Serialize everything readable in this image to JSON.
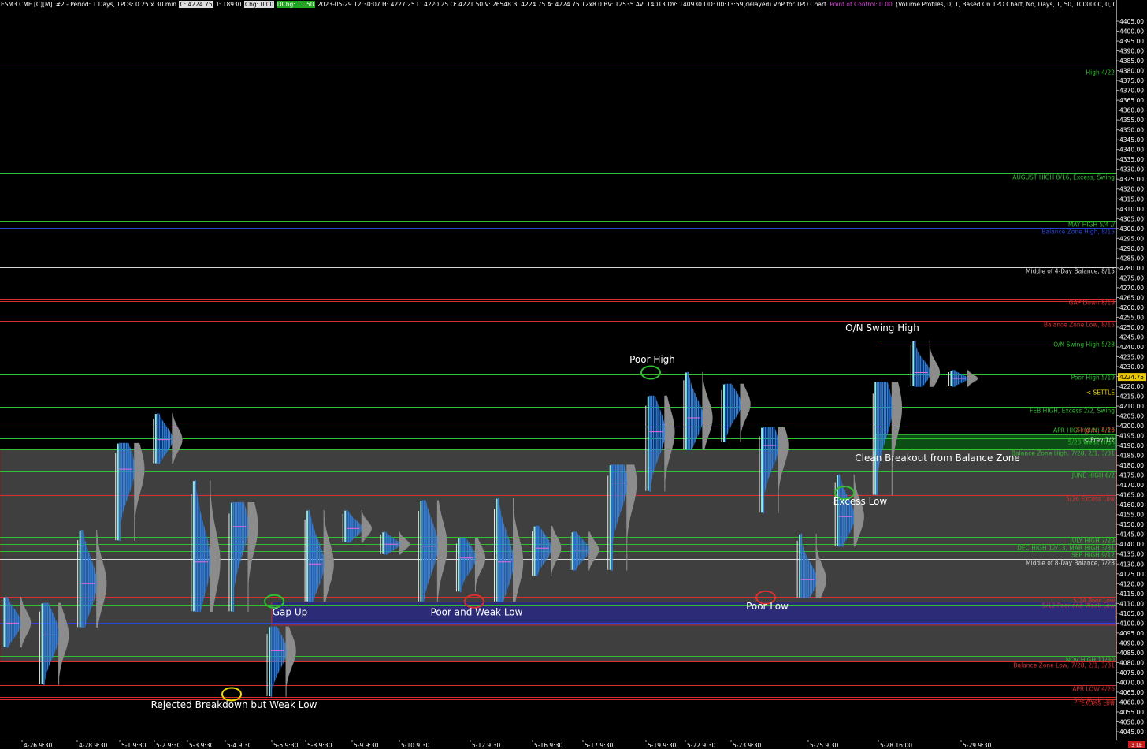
{
  "header": {
    "symbol": "ESM3.CME [C][M]",
    "period": "#2 - Period: 1 Days, TPOs: 0.25 x 30 min",
    "last": "C: 4224.75",
    "ticks": "T: 18930",
    "change": "Chg: 0.00",
    "dchange": "DChg: 11.50",
    "stats": "2023-05-29 12:30:07 H: 4227.25 L: 4220.25 O: 4221.50 V: 26548 B: 4224.75 A: 4224.75 12x8 0 BV: 12535 AV: 14013 DV: 140930 DD: 00:13:59(delayed) VbP for TPO Chart",
    "poc": "Point of Control: 0.00",
    "study": "(Volume Profiles, 0, 1, Based On TPO Chart, No, Days, 1, 50, 1000000, 0, 0, No, 00:00:00,"
  },
  "colors": {
    "background": "#000000",
    "balance_zone": "#3f3f3f",
    "gap_zone": "#2b2b78",
    "green_line": "#2fbf2f",
    "red_line": "#d83030",
    "white_line": "#d8d8d8",
    "blue_line": "#2a45d8",
    "profile_blue": "#2f7fe0",
    "profile_cyan": "#8fe8e8",
    "volume_gray": "#8c8c8c",
    "last_price_box": "#e8c800"
  },
  "badge": "3 LE",
  "chart_data": {
    "type": "market-profile",
    "title": "",
    "ylim": [
      4041,
      4411
    ],
    "y_ticks_step": 5,
    "current_price": "4224.75",
    "x_labels": [
      "4-26 9:30",
      "4-28 9:30",
      "5-1 9:30",
      "5-2 9:30",
      "5-3 9:30",
      "5-4 9:30",
      "5-5 9:30",
      "5-8 9:30",
      "5-9 9:30",
      "5-10 9:30",
      "5-12 9:30",
      "5-16 9:30",
      "5-17 9:30",
      "5-19 9:30",
      "5-22 9:30",
      "5-23 9:30",
      "5-25 9:30",
      "5-28 16:00",
      "5-29 9:30"
    ],
    "levels": [
      {
        "price": 4381,
        "label": "High 4/22",
        "color": "green"
      },
      {
        "price": 4328,
        "label": "AUGUST HIGH 8/16, Excess, Swing",
        "color": "green"
      },
      {
        "price": 4304,
        "label": "MAY HIGH 5/4 //",
        "color": "green"
      },
      {
        "price": 4300.5,
        "label": "Balance Zone High, 8/15",
        "color": "blue",
        "tag": "4300"
      },
      {
        "price": 4280.5,
        "label": "Middle of 4-Day Balance, 8/15",
        "color": "white"
      },
      {
        "price": 4264.5,
        "label": "GAP Down 8/19",
        "color": "red"
      },
      {
        "price": 4263,
        "label": "",
        "color": "red"
      },
      {
        "price": 4253,
        "label": "Balance Zone Low, 8/15",
        "color": "red"
      },
      {
        "price": 4243.25,
        "label": "O/N Swing High 5/28",
        "color": "green"
      },
      {
        "price": 4226.5,
        "label": "Poor High 5/19",
        "color": "green"
      },
      {
        "price": 4209.5,
        "label": "FEB HIGH, Excess 2/2, Swing",
        "color": "green"
      },
      {
        "price": 4199.5,
        "label": "APR HIGH (O/N) 4/10",
        "color": "green",
        "tag": "4200"
      },
      {
        "price": 4193.5,
        "label": "5/23 Weak High",
        "color": "green"
      },
      {
        "price": 4188,
        "label": "Balance Zone High, 7/28, 2/1, 3/31",
        "color": "green"
      },
      {
        "price": 4177,
        "label": "JUNE HIGH 6/2",
        "color": "green"
      },
      {
        "price": 4165,
        "label": "5/26 Excess Low",
        "color": "red"
      },
      {
        "price": 4143.5,
        "label": "JULY HIGH 7/29",
        "color": "green"
      },
      {
        "price": 4140,
        "label": "DEC HIGH 12/13, MAR HIGH 3/31",
        "color": "green"
      },
      {
        "price": 4136.5,
        "label": "SEP HIGH 9/12",
        "color": "green"
      },
      {
        "price": 4132.5,
        "label": "Middle of 8-Day Balance, 7/28",
        "color": "white"
      },
      {
        "price": 4113.25,
        "label": "5/24 Poor Low",
        "color": "red"
      },
      {
        "price": 4110.75,
        "label": "5/12 Poor and Weak Low",
        "color": "red"
      },
      {
        "price": 4109.5,
        "label": "",
        "color": "green"
      },
      {
        "price": 4100,
        "label": "",
        "color": "blue",
        "tag": "4100"
      },
      {
        "price": 4083.5,
        "label": "NOV HIGH 11/30",
        "color": "green"
      },
      {
        "price": 4080.5,
        "label": "Balance Zone Low, 7/28, 2/1, 3/31",
        "color": "red"
      },
      {
        "price": 4068.75,
        "label": "APR LOW 4/26",
        "color": "red"
      },
      {
        "price": 4062.5,
        "label": "5/4 Weak Low",
        "color": "red"
      },
      {
        "price": 4061.25,
        "label": "Excess Low",
        "color": "red"
      }
    ],
    "zones": [
      {
        "name": "balance-zone",
        "from": 4080.5,
        "to": 4188
      },
      {
        "name": "gap-zone",
        "from": 4099,
        "to": 4110.75
      },
      {
        "name": "singles-zone",
        "from": 4188,
        "to": 4195.5
      }
    ],
    "right_tags": [
      {
        "price": 4217,
        "text": "< SETTLE",
        "color": "yellow"
      },
      {
        "price": 4198,
        "text": "Singles, 5/26",
        "color": "red"
      },
      {
        "price": 4193,
        "text": "< Prev 1/2",
        "color": "white"
      }
    ],
    "sessions": [
      {
        "date": "4-26",
        "low": 4088,
        "high": 4113,
        "poc": 4100
      },
      {
        "date": "4-27",
        "low": 4069,
        "high": 4110,
        "poc": 4094
      },
      {
        "date": "4-27b",
        "low": 4098,
        "high": 4147,
        "poc": 4120
      },
      {
        "date": "4-28",
        "low": 4142,
        "high": 4191,
        "poc": 4178
      },
      {
        "date": "5-1",
        "low": 4181,
        "high": 4206,
        "poc": 4193
      },
      {
        "date": "5-2",
        "low": 4106,
        "high": 4172,
        "poc": 4131
      },
      {
        "date": "5-3",
        "low": 4106,
        "high": 4161,
        "poc": 4149
      },
      {
        "date": "5-4",
        "low": 4063,
        "high": 4098,
        "poc": 4086
      },
      {
        "date": "5-5",
        "low": 4111,
        "high": 4157,
        "poc": 4130
      },
      {
        "date": "5-8",
        "low": 4141,
        "high": 4157,
        "poc": 4148
      },
      {
        "date": "5-9",
        "low": 4135,
        "high": 4146,
        "poc": 4140
      },
      {
        "date": "5-10",
        "low": 4111,
        "high": 4162,
        "poc": 4139
      },
      {
        "date": "5-11",
        "low": 4116,
        "high": 4143,
        "poc": 4133
      },
      {
        "date": "5-12",
        "low": 4111,
        "high": 4163,
        "poc": 4131
      },
      {
        "date": "5-15",
        "low": 4124,
        "high": 4149,
        "poc": 4138
      },
      {
        "date": "5-16",
        "low": 4127,
        "high": 4146,
        "poc": 4137
      },
      {
        "date": "5-17",
        "low": 4127,
        "high": 4180,
        "poc": 4171
      },
      {
        "date": "5-18",
        "low": 4167,
        "high": 4215,
        "poc": 4197
      },
      {
        "date": "5-19",
        "low": 4188,
        "high": 4227,
        "poc": 4204
      },
      {
        "date": "5-22",
        "low": 4192,
        "high": 4221,
        "poc": 4211
      },
      {
        "date": "5-23",
        "low": 4156,
        "high": 4199,
        "poc": 4190
      },
      {
        "date": "5-24",
        "low": 4113,
        "high": 4145,
        "poc": 4122
      },
      {
        "date": "5-25",
        "low": 4139,
        "high": 4175,
        "poc": 4154
      },
      {
        "date": "5-26",
        "low": 4165,
        "high": 4222,
        "poc": 4209
      },
      {
        "date": "5-28",
        "low": 4220,
        "high": 4243,
        "poc": 4227
      },
      {
        "date": "5-29",
        "low": 4220,
        "high": 4228,
        "poc": 4224
      }
    ],
    "annotations": [
      {
        "text": "O/N Swing High",
        "price": 4248,
        "circle": null
      },
      {
        "text": "Poor High",
        "price": 4232,
        "circle": "green"
      },
      {
        "text": "Clean Breakout from Balance Zone",
        "price": 4182,
        "circle": null
      },
      {
        "text": "Excess Low",
        "price": 4160,
        "circle": "green"
      },
      {
        "text": "Gap Up",
        "price": 4104,
        "circle": "green"
      },
      {
        "text": "Poor and Weak Low",
        "price": 4104,
        "circle": "red"
      },
      {
        "text": "Poor Low",
        "price": 4107,
        "circle": "red"
      },
      {
        "text": "Rejected Breakdown but Weak Low",
        "price": 4057,
        "circle": "yellow"
      }
    ]
  }
}
